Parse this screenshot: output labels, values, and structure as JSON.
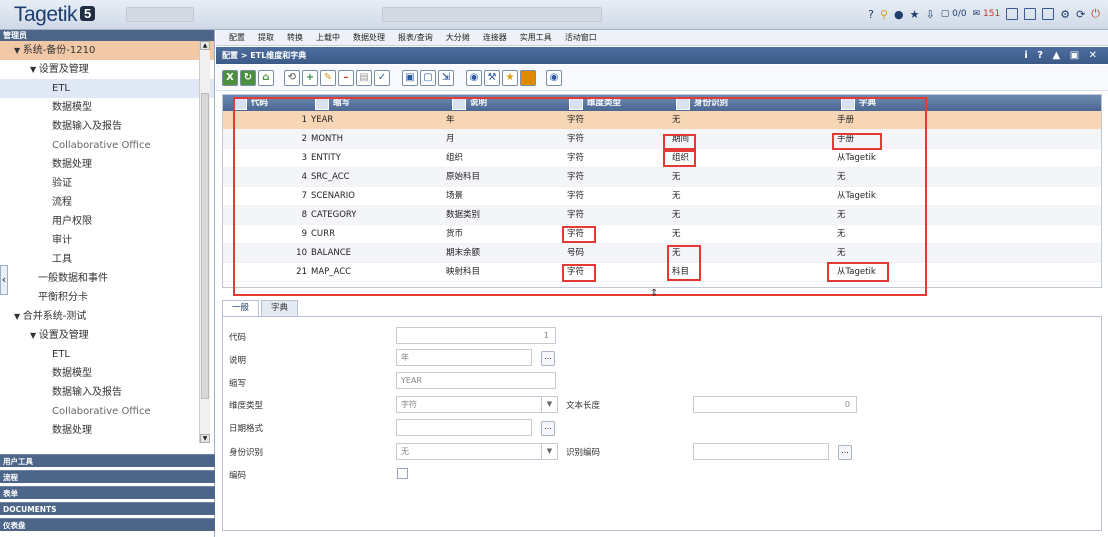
{
  "app": {
    "logo_text": "Tagetik",
    "logo_version": "5"
  },
  "topbar": {
    "message_count": "0/0",
    "notification_count": "151"
  },
  "sidebar": {
    "header": "管理员",
    "items": [
      {
        "label": "系统-备份-1210",
        "indent": 14,
        "prefix": "▼"
      },
      {
        "label": "设置及管理",
        "indent": 30,
        "prefix": "▼"
      },
      {
        "label": "ETL",
        "indent": 52
      },
      {
        "label": "数据模型",
        "indent": 52
      },
      {
        "label": "数据输入及报告",
        "indent": 52
      },
      {
        "label": "Collaborative Office",
        "indent": 52
      },
      {
        "label": "数据处理",
        "indent": 52
      },
      {
        "label": "验证",
        "indent": 52
      },
      {
        "label": "流程",
        "indent": 52
      },
      {
        "label": "用户权限",
        "indent": 52
      },
      {
        "label": "审计",
        "indent": 52
      },
      {
        "label": "工具",
        "indent": 52
      },
      {
        "label": "一般数据和事件",
        "indent": 38
      },
      {
        "label": "平衡积分卡",
        "indent": 38
      },
      {
        "label": "合并系统-测试",
        "indent": 14,
        "prefix": "▼"
      },
      {
        "label": "设置及管理",
        "indent": 30,
        "prefix": "▼"
      },
      {
        "label": "ETL",
        "indent": 52
      },
      {
        "label": "数据模型",
        "indent": 52
      },
      {
        "label": "数据输入及报告",
        "indent": 52
      },
      {
        "label": "Collaborative Office",
        "indent": 52
      },
      {
        "label": "数据处理",
        "indent": 52
      }
    ],
    "footer": [
      "用户工具",
      "流程",
      "表单",
      "DOCUMENTS",
      "仪表盘"
    ]
  },
  "menu": [
    "配置",
    "提取",
    "转换",
    "上载中",
    "数据处理",
    "报表/查询",
    "大分摊",
    "连接器",
    "实用工具",
    "活动窗口"
  ],
  "panel": {
    "title": "配置 > ETL维度和字典"
  },
  "grid": {
    "columns": [
      "代码",
      "缩写",
      "说明",
      "维度类型",
      "身份识别",
      "字典"
    ],
    "rows": [
      {
        "code": "1",
        "abbr": "YEAR",
        "desc": "年",
        "type": "字符",
        "ident": "无",
        "dict": "手册"
      },
      {
        "code": "2",
        "abbr": "MONTH",
        "desc": "月",
        "type": "字符",
        "ident": "期间",
        "dict": "手册"
      },
      {
        "code": "3",
        "abbr": "ENTITY",
        "desc": "组织",
        "type": "字符",
        "ident": "组织",
        "dict": "从Tagetik"
      },
      {
        "code": "4",
        "abbr": "SRC_ACC",
        "desc": "原始科目",
        "type": "字符",
        "ident": "无",
        "dict": "无"
      },
      {
        "code": "7",
        "abbr": "SCENARIO",
        "desc": "场景",
        "type": "字符",
        "ident": "无",
        "dict": "从Tagetik"
      },
      {
        "code": "8",
        "abbr": "CATEGORY",
        "desc": "数据类别",
        "type": "字符",
        "ident": "无",
        "dict": "无"
      },
      {
        "code": "9",
        "abbr": "CURR",
        "desc": "货币",
        "type": "字符",
        "ident": "无",
        "dict": "无"
      },
      {
        "code": "10",
        "abbr": "BALANCE",
        "desc": "期末余额",
        "type": "号码",
        "ident": "无",
        "dict": "无"
      },
      {
        "code": "21",
        "abbr": "MAP_ACC",
        "desc": "映射科目",
        "type": "字符",
        "ident": "科目",
        "dict": "从Tagetik"
      }
    ]
  },
  "tabs": [
    "一般",
    "字典"
  ],
  "form": {
    "code_label": "代码",
    "code_value": "1",
    "desc_label": "说明",
    "desc_value": "年",
    "abbr_label": "缩写",
    "abbr_value": "YEAR",
    "type_label": "维度类型",
    "type_value": "字符",
    "textlen_label": "文本长度",
    "textlen_value": "0",
    "datefmt_label": "日期格式",
    "ident_label": "身份识别",
    "ident_value": "无",
    "idcode_label": "识别编码",
    "encode_label": "编码"
  }
}
